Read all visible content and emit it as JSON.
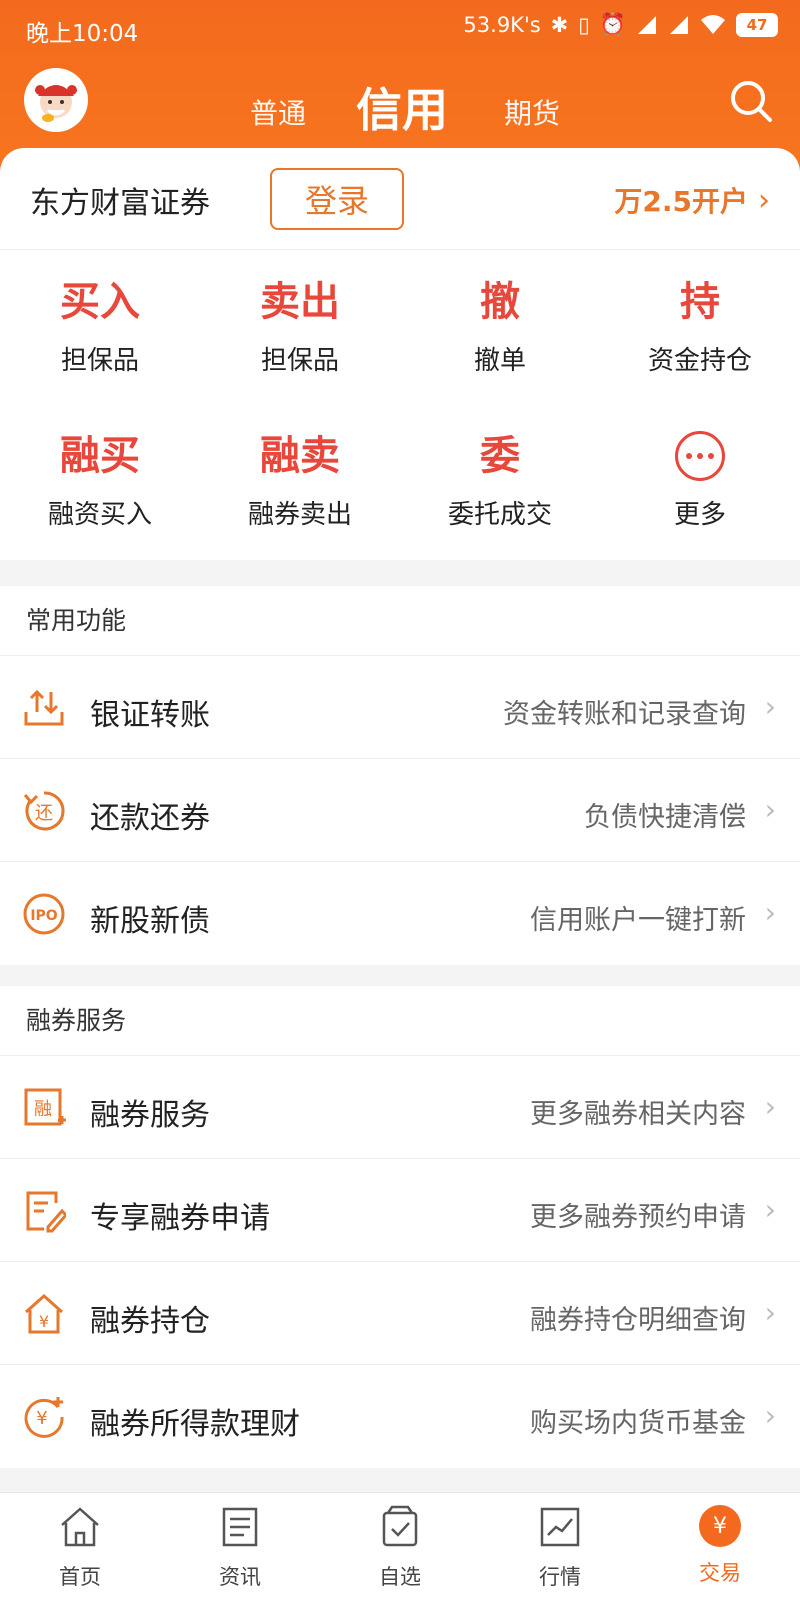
{
  "status_bar": {
    "time": "晚上10:04",
    "speed": "53.9K's",
    "battery": "47"
  },
  "top_tabs": [
    {
      "label": "普通"
    },
    {
      "label": "信用"
    },
    {
      "label": "期货"
    }
  ],
  "broker": {
    "name": "东方财富证券",
    "login_label": "登录",
    "open_account_label": "万2.5开户"
  },
  "quick_actions": [
    {
      "big": "买入",
      "sub": "担保品"
    },
    {
      "big": "卖出",
      "sub": "担保品"
    },
    {
      "big": "撤",
      "sub": "撤单"
    },
    {
      "big": "持",
      "sub": "资金持仓"
    },
    {
      "big": "融买",
      "sub": "融资买入"
    },
    {
      "big": "融卖",
      "sub": "融券卖出"
    },
    {
      "big": "委",
      "sub": "委托成交"
    },
    {
      "big": "",
      "sub": "更多",
      "icon": "more-dots-icon"
    }
  ],
  "common_functions": {
    "title": "常用功能",
    "rows": [
      {
        "icon": "bank-transfer-icon",
        "title": "银证转账",
        "desc": "资金转账和记录查询"
      },
      {
        "icon": "repay-icon",
        "title": "还款还券",
        "desc": "负债快捷清偿"
      },
      {
        "icon": "ipo-icon",
        "title": "新股新债",
        "desc": "信用账户一键打新"
      }
    ]
  },
  "securities_lending": {
    "title": "融券服务",
    "rows": [
      {
        "icon": "lending-service-icon",
        "title": "融券服务",
        "desc": "更多融券相关内容"
      },
      {
        "icon": "apply-form-icon",
        "title": "专享融券申请",
        "desc": "更多融券预约申请"
      },
      {
        "icon": "house-yen-icon",
        "title": "融券持仓",
        "desc": "融券持仓明细查询"
      },
      {
        "icon": "yen-finance-icon",
        "title": "融券所得款理财",
        "desc": "购买场内货币基金"
      }
    ]
  },
  "bottom_nav": [
    {
      "label": "首页",
      "icon": "home-icon"
    },
    {
      "label": "资讯",
      "icon": "news-icon"
    },
    {
      "label": "自选",
      "icon": "watchlist-icon"
    },
    {
      "label": "行情",
      "icon": "market-chart-icon"
    },
    {
      "label": "交易",
      "icon": "trade-icon",
      "active": true,
      "badge": "¥"
    }
  ],
  "colors": {
    "brand_orange": "#f36a1e",
    "action_red": "#e8473b",
    "accent_orange": "#e6772b"
  }
}
